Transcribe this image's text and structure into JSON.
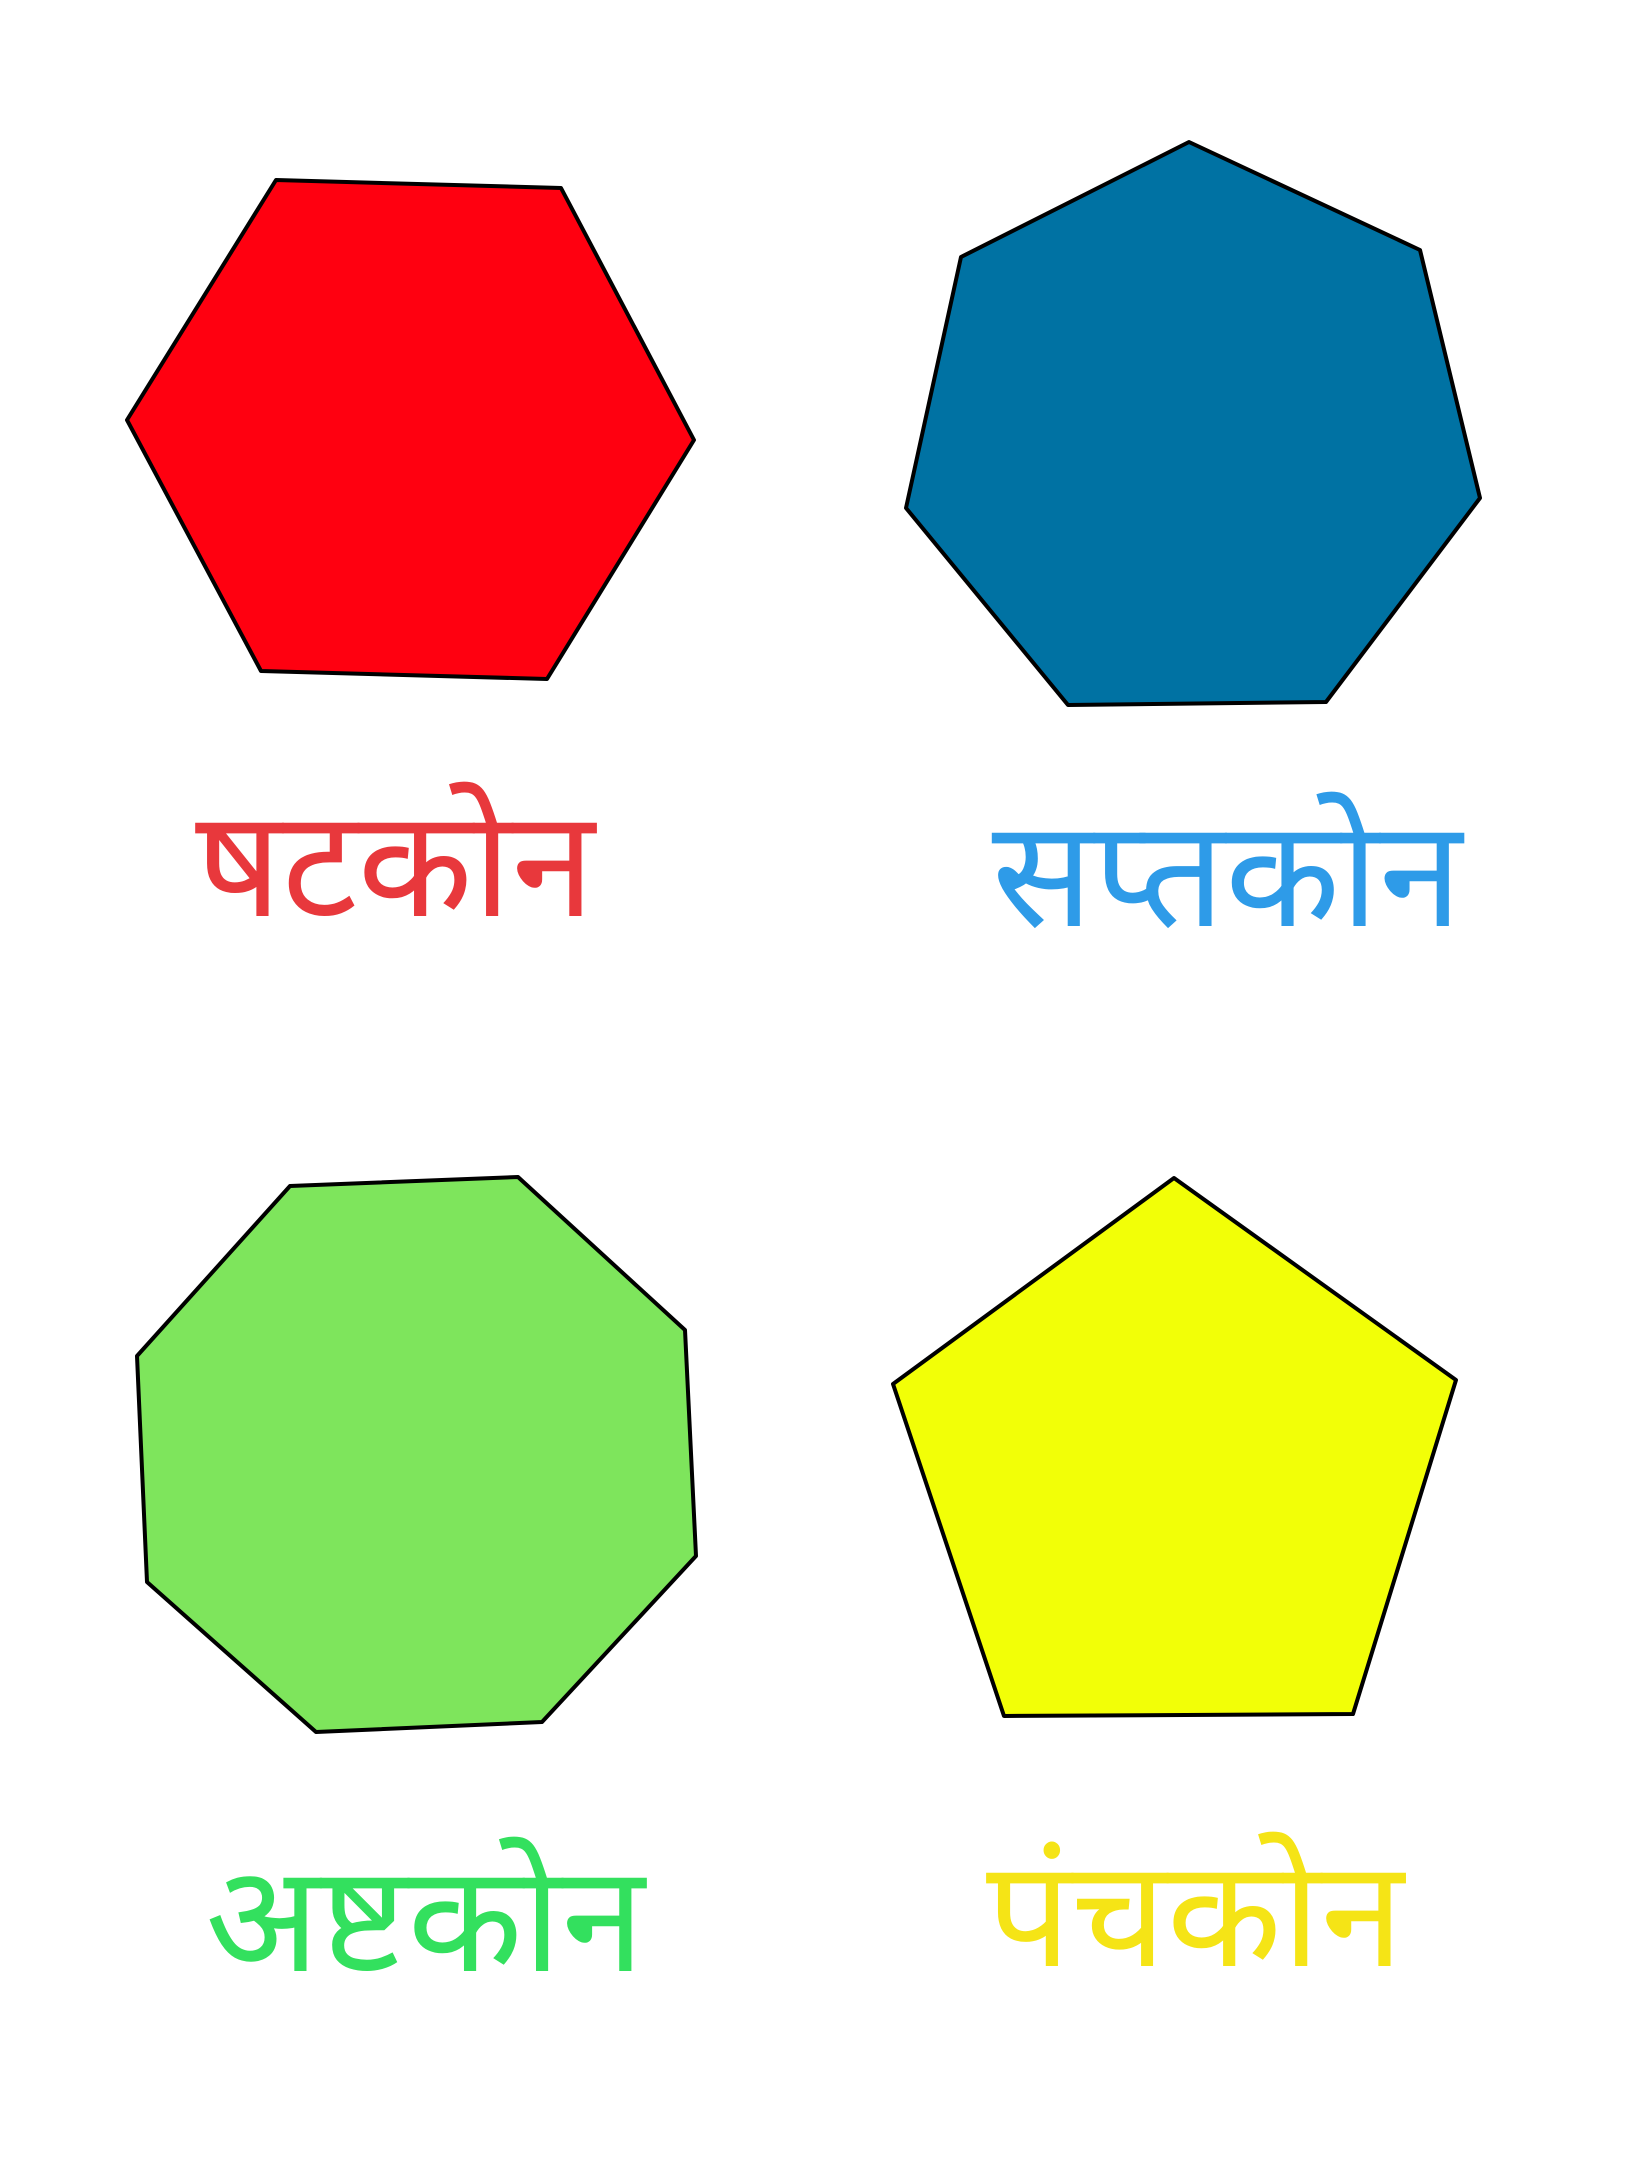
{
  "shapes": [
    {
      "id": "hexagon",
      "label": "षटकोन",
      "fill": "#ff0010",
      "label_color": "#e8383c"
    },
    {
      "id": "heptagon",
      "label": "सप्तकोन",
      "fill": "#0072a3",
      "label_color": "#2e9be8"
    },
    {
      "id": "octagon",
      "label": "अष्टकोन",
      "fill": "#7ee55c",
      "label_color": "#33e05e"
    },
    {
      "id": "pentagon",
      "label": "पंचकोन",
      "fill": "#f2ff07",
      "label_color": "#f5e416"
    }
  ]
}
